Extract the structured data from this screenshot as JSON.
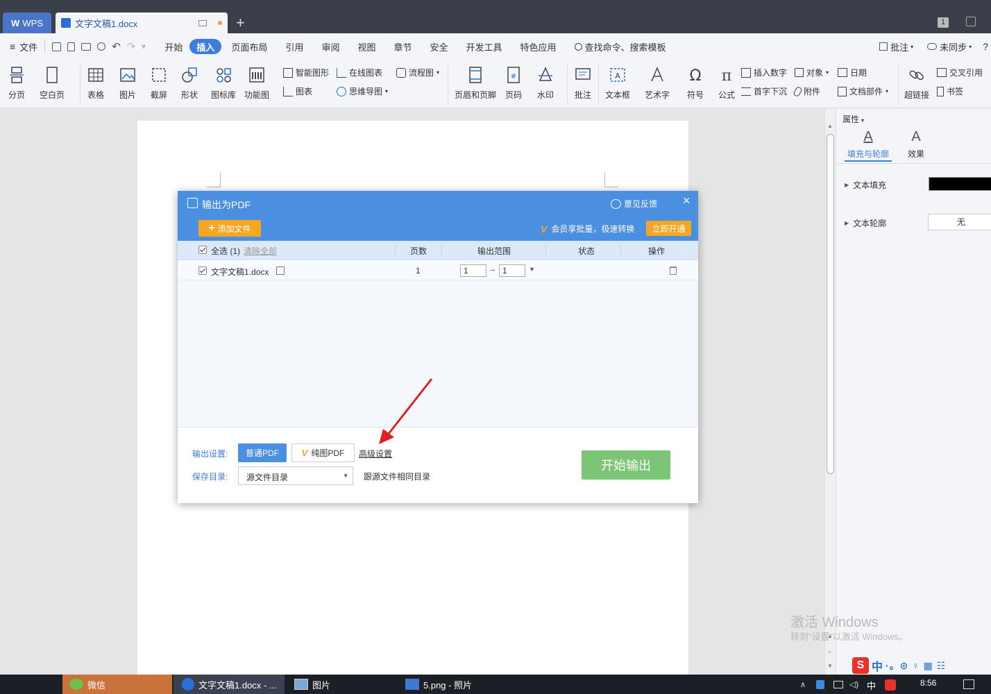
{
  "titlebar": {
    "app_tab": "WPS",
    "doc_tab": "文字文稿1.docx",
    "window_count": "1"
  },
  "menubar": {
    "file": "文件",
    "items": [
      "开始",
      "插入",
      "页面布局",
      "引用",
      "审阅",
      "视图",
      "章节",
      "安全",
      "开发工具",
      "特色应用"
    ],
    "active": "插入",
    "search": "查找命令、搜索模板",
    "comment": "批注",
    "sync": "未同步"
  },
  "ribbon": {
    "page_break": "分页",
    "blank_page": "空白页",
    "table": "表格",
    "picture": "图片",
    "screenshot": "截屏",
    "shape": "形状",
    "icon_lib": "图标库",
    "func_chart": "功能图",
    "smart_shape": "智能图形",
    "chart": "图表",
    "online_chart": "在线图表",
    "mind_map": "思维导图",
    "flowchart": "流程图",
    "header_footer": "页眉和页脚",
    "page_number": "页码",
    "watermark": "水印",
    "comment": "批注",
    "textbox": "文本框",
    "wordart": "艺术字",
    "symbol": "符号",
    "formula": "公式",
    "insert_number": "插入数字",
    "drop_cap": "首字下沉",
    "object": "对象",
    "attachment": "附件",
    "date": "日期",
    "doc_parts": "文档部件",
    "hyperlink": "超链接",
    "cross_ref": "交叉引用",
    "bookmark": "书签"
  },
  "right_pane": {
    "title": "属性",
    "tab_fill": "填充与轮廓",
    "tab_effect": "效果",
    "text_fill": "文本填充",
    "text_outline": "文本轮廓",
    "outline_value": "无",
    "fill_color": "#000000"
  },
  "dialog": {
    "title": "输出为PDF",
    "feedback": "意见反馈",
    "add_file": "添加文件",
    "vip_text": "会员享批量，极速转换",
    "vip_button": "立即开通",
    "head_select_all": "全选 (1)",
    "head_clear": "清除全部",
    "head_pages": "页数",
    "head_range": "输出范围",
    "head_status": "状态",
    "head_action": "操作",
    "rows": [
      {
        "name": "文字文稿1.docx",
        "pages": "1",
        "from": "1",
        "to": "1"
      }
    ],
    "output_settings_label": "输出设置:",
    "normal_pdf": "普通PDF",
    "image_pdf": "纯图PDF",
    "advanced": "高级设置",
    "save_dir_label": "保存目录:",
    "save_dir_value": "源文件目录",
    "save_dir_hint": "跟源文件相同目录",
    "start": "开始输出"
  },
  "watermark_overlay": {
    "line1": "激活 Windows",
    "line2": "转到“设置”以激活 Windows。"
  },
  "taskbar": {
    "items": [
      "微信",
      "文字文稿1.docx - ...",
      "图片",
      "5.png - 照片"
    ],
    "time": "8:56",
    "ime": "中"
  },
  "colors": {
    "accent": "#3c7de0",
    "dialog_header": "#4a8fe0",
    "add_button": "#f5a623",
    "start_button": "#7cc576",
    "arrow": "#e02020"
  }
}
